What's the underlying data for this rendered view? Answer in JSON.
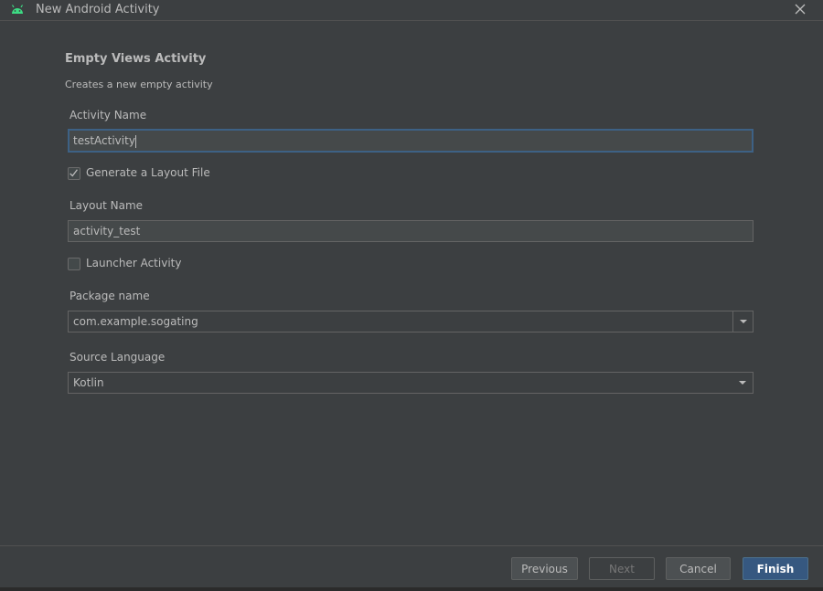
{
  "window": {
    "title": "New Android Activity",
    "icon": "android-icon",
    "close_icon": "close-icon"
  },
  "template": {
    "title": "Empty Views Activity",
    "description": "Creates a new empty activity"
  },
  "form": {
    "activity_name": {
      "label": "Activity Name",
      "value": "testActivity"
    },
    "generate_layout": {
      "label": "Generate a Layout File",
      "checked": true
    },
    "layout_name": {
      "label": "Layout Name",
      "value": "activity_test"
    },
    "launcher_activity": {
      "label": "Launcher Activity",
      "checked": false
    },
    "package_name": {
      "label": "Package name",
      "value": "com.example.sogating"
    },
    "source_language": {
      "label": "Source Language",
      "value": "Kotlin"
    }
  },
  "buttons": {
    "previous": "Previous",
    "next": "Next",
    "cancel": "Cancel",
    "finish": "Finish"
  },
  "colors": {
    "background": "#3c3f41",
    "accent": "#365880",
    "focus_border": "#3d6185",
    "android_green": "#3ddc84"
  }
}
